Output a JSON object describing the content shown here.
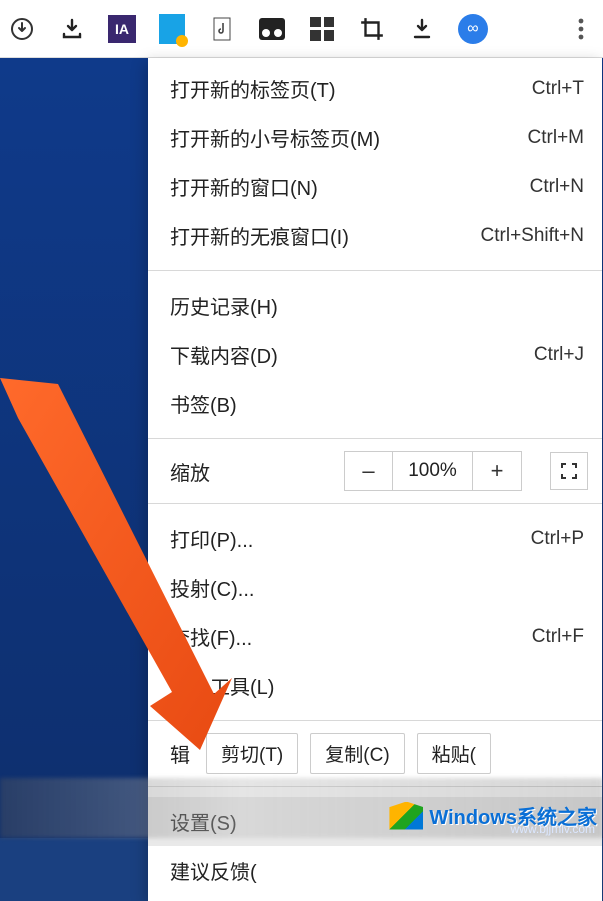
{
  "toolbar": {
    "icons": [
      {
        "name": "circle-download-icon"
      },
      {
        "name": "download-tray-icon"
      },
      {
        "name": "ia-extension-icon"
      },
      {
        "name": "file-download-extension-icon"
      },
      {
        "name": "music-note-extension-icon"
      },
      {
        "name": "image-extension-icon"
      },
      {
        "name": "grid-extension-icon"
      },
      {
        "name": "crop-icon"
      },
      {
        "name": "download-arrow-icon"
      }
    ],
    "avatar_symbol": "∞"
  },
  "menu": {
    "section1": [
      {
        "label": "打开新的标签页(T)",
        "shortcut": "Ctrl+T"
      },
      {
        "label": "打开新的小号标签页(M)",
        "shortcut": "Ctrl+M"
      },
      {
        "label": "打开新的窗口(N)",
        "shortcut": "Ctrl+N"
      },
      {
        "label": "打开新的无痕窗口(I)",
        "shortcut": "Ctrl+Shift+N"
      }
    ],
    "section2": [
      {
        "label": "历史记录(H)",
        "shortcut": ""
      },
      {
        "label": "下载内容(D)",
        "shortcut": "Ctrl+J"
      },
      {
        "label": "书签(B)",
        "shortcut": ""
      }
    ],
    "zoom": {
      "label": "缩放",
      "minus": "–",
      "value": "100%",
      "plus": "+"
    },
    "section3": [
      {
        "label": "打印(P)...",
        "shortcut": "Ctrl+P"
      },
      {
        "label": "投射(C)...",
        "shortcut": ""
      },
      {
        "label": "查找(F)...",
        "shortcut": "Ctrl+F"
      },
      {
        "label": "更多工具(L)",
        "shortcut": ""
      }
    ],
    "edit": {
      "label": "辑",
      "cut": "剪切(T)",
      "copy": "复制(C)",
      "paste": "粘贴("
    },
    "section4": [
      {
        "label": "设置(S)",
        "shortcut": "",
        "hover": true
      },
      {
        "label": "建议反馈(",
        "shortcut": ""
      }
    ]
  },
  "watermark": {
    "title": "Windows系统之家",
    "url": "www.bjjmlv.com"
  }
}
